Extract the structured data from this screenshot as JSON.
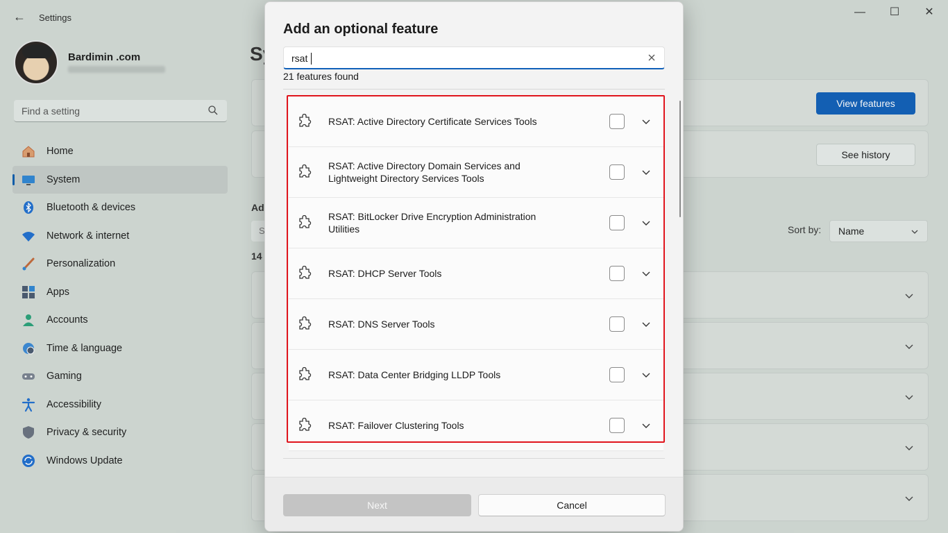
{
  "window": {
    "app_title": "Settings",
    "back_icon": "back-arrow-icon",
    "controls": [
      "minimize-icon",
      "maximize-icon",
      "close-icon"
    ]
  },
  "profile": {
    "name": "Bardimin .com"
  },
  "sidebar": {
    "search_placeholder": "Find a setting",
    "items": [
      {
        "label": "Home",
        "icon": "home-icon",
        "active": false
      },
      {
        "label": "System",
        "icon": "monitor-icon",
        "active": true
      },
      {
        "label": "Bluetooth & devices",
        "icon": "bluetooth-icon",
        "active": false
      },
      {
        "label": "Network & internet",
        "icon": "wifi-icon",
        "active": false
      },
      {
        "label": "Personalization",
        "icon": "brush-icon",
        "active": false
      },
      {
        "label": "Apps",
        "icon": "apps-icon",
        "active": false
      },
      {
        "label": "Accounts",
        "icon": "person-icon",
        "active": false
      },
      {
        "label": "Time & language",
        "icon": "globe-clock-icon",
        "active": false
      },
      {
        "label": "Gaming",
        "icon": "gamepad-icon",
        "active": false
      },
      {
        "label": "Accessibility",
        "icon": "accessibility-icon",
        "active": false
      },
      {
        "label": "Privacy & security",
        "icon": "shield-icon",
        "active": false
      },
      {
        "label": "Windows Update",
        "icon": "refresh-icon",
        "active": false
      }
    ]
  },
  "main": {
    "title_fragment": "Sy",
    "view_features": "View features",
    "see_history": "See history",
    "section_fragment": "Ad",
    "search_fragment": "S",
    "count_fragment": "14",
    "sort_label": "Sort by:",
    "sort_value": "Name"
  },
  "dialog": {
    "title": "Add an optional feature",
    "search_value": "rsat",
    "found_text": "21 features found",
    "features": [
      {
        "name": "RSAT: Active Directory Certificate Services Tools",
        "checked": false
      },
      {
        "name": "RSAT: Active Directory Domain Services and Lightweight Directory Services Tools",
        "checked": false
      },
      {
        "name": "RSAT: BitLocker Drive Encryption Administration Utilities",
        "checked": false
      },
      {
        "name": "RSAT: DHCP Server Tools",
        "checked": false
      },
      {
        "name": "RSAT: DNS Server Tools",
        "checked": false
      },
      {
        "name": "RSAT: Data Center Bridging LLDP Tools",
        "checked": false
      },
      {
        "name": "RSAT: Failover Clustering Tools",
        "checked": false
      }
    ],
    "next_label": "Next",
    "cancel_label": "Cancel"
  },
  "colors": {
    "accent": "#0f5fb8",
    "highlight_border": "#e0141c"
  }
}
